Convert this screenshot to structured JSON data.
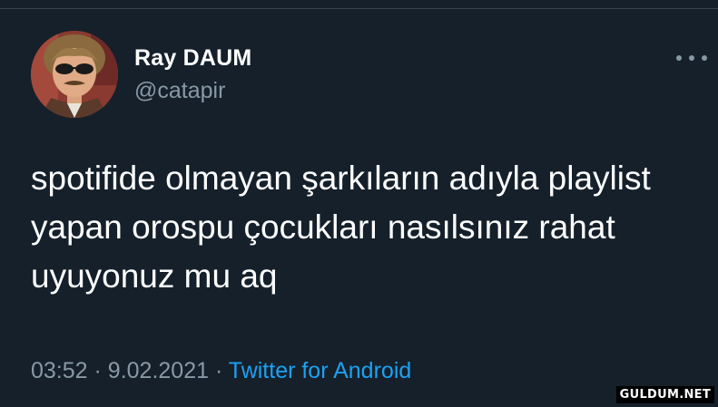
{
  "author": {
    "name": "Ray DAUM",
    "handle": "@catapir"
  },
  "more_icon": "more-horizontal-icon",
  "tweet": {
    "text": "spotifide olmayan şarkıların adıyla playlist\nyapan orospu çocukları nasılsınız rahat\nuyuyonuz mu aq"
  },
  "meta": {
    "time": "03:52",
    "separator": "·",
    "date": "9.02.2021",
    "source": "Twitter for Android"
  },
  "watermark": "GULDUM.NET",
  "colors": {
    "background": "#15202b",
    "text": "#ffffff",
    "secondary": "#8899a6",
    "link": "#1da1f2"
  }
}
